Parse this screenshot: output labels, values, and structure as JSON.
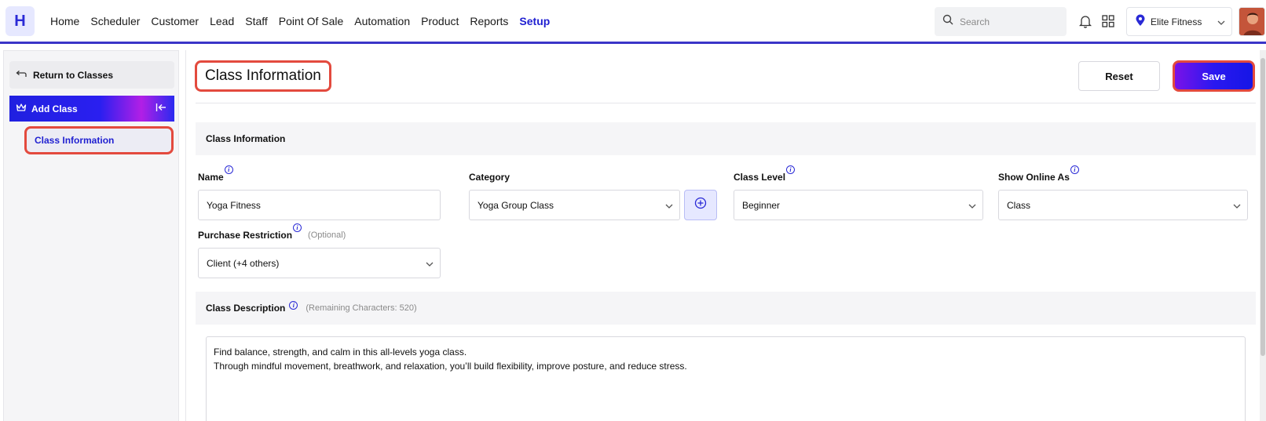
{
  "app": {
    "logo_letter": "H",
    "brand_color": "#2a2ad6"
  },
  "nav": {
    "items": [
      {
        "label": "Home",
        "active": false
      },
      {
        "label": "Scheduler",
        "active": false
      },
      {
        "label": "Customer",
        "active": false
      },
      {
        "label": "Lead",
        "active": false
      },
      {
        "label": "Staff",
        "active": false
      },
      {
        "label": "Point Of Sale",
        "active": false
      },
      {
        "label": "Automation",
        "active": false
      },
      {
        "label": "Product",
        "active": false
      },
      {
        "label": "Reports",
        "active": false
      },
      {
        "label": "Setup",
        "active": true
      }
    ]
  },
  "header": {
    "search_placeholder": "Search",
    "location": "Elite Fitness"
  },
  "sidebar": {
    "back_label": "Return to Classes",
    "group_label": "Add Class",
    "sub_items": [
      {
        "label": "Class Information",
        "active": true
      }
    ]
  },
  "main": {
    "page_title": "Class Information",
    "reset_label": "Reset",
    "save_label": "Save",
    "section_title": "Class Information",
    "fields": {
      "name": {
        "label": "Name",
        "value": "Yoga  Fitness"
      },
      "category": {
        "label": "Category",
        "value": "Yoga Group Class"
      },
      "class_level": {
        "label": "Class Level",
        "value": "Beginner"
      },
      "show_online_as": {
        "label": "Show Online As",
        "value": "Class"
      },
      "purchase_restriction": {
        "label": "Purchase Restriction",
        "optional": "(Optional)",
        "value": "Client (+4 others)"
      }
    },
    "description": {
      "label": "Class Description",
      "remaining": "(Remaining Characters: 520)",
      "line1": "Find balance, strength, and calm in this all-levels yoga class.",
      "line2": "Through mindful movement, breathwork, and relaxation, you’ll build flexibility, improve posture, and reduce stress."
    }
  }
}
